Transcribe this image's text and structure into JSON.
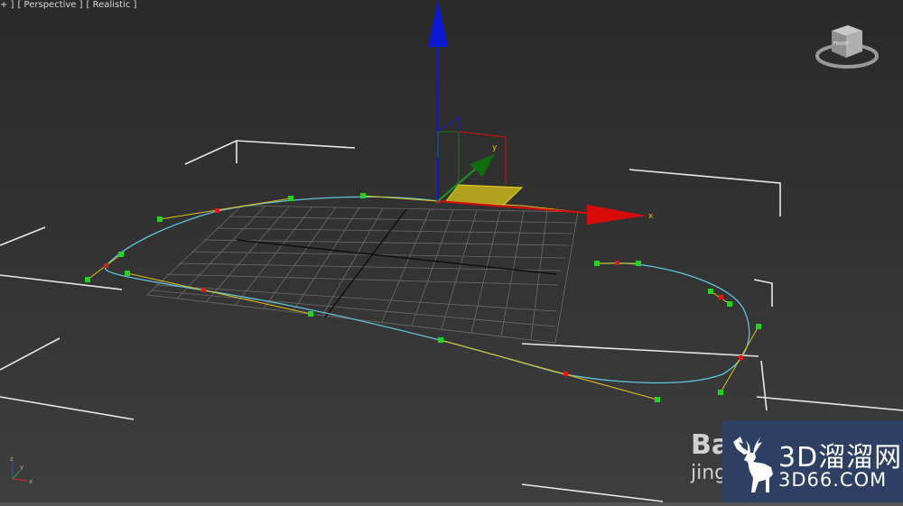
{
  "viewport": {
    "menu_plus": "+ ]",
    "view_label": "[ Perspective ]",
    "shading_label": "[ Realistic ]"
  },
  "gizmo": {
    "x_label": "x",
    "y_label": "y"
  },
  "viewcube": {
    "face_label": "FRONT"
  },
  "axis_tripod": {
    "x_label": "x",
    "y_label": "y",
    "z_label": "z"
  },
  "watermark": {
    "site_name": "3D溜溜网",
    "site_url": "3D66.COM",
    "baidu_logo": "Ba",
    "baidu_sub": "jing"
  },
  "colors": {
    "spline": "#5fc4dc",
    "tangent": "#e0c21a",
    "handle": "#22d322",
    "vertex": "#e01818",
    "axis_x": "#d80a0a",
    "axis_y": "#1a9a1a",
    "axis_z": "#0c1ad6",
    "plane": "#e6d51f",
    "watermark_bg": "#2d3f63"
  }
}
